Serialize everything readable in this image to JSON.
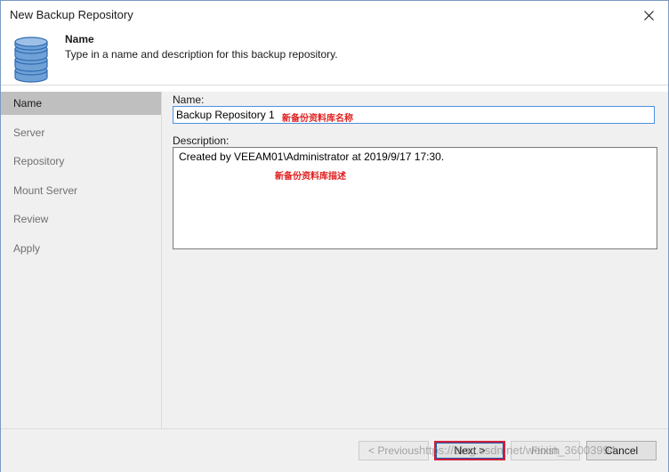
{
  "window": {
    "title": "New Backup Repository"
  },
  "header": {
    "title": "Name",
    "subtitle": "Type in a name and description for this backup repository."
  },
  "sidebar": {
    "items": [
      {
        "label": "Name",
        "active": true
      },
      {
        "label": "Server",
        "active": false
      },
      {
        "label": "Repository",
        "active": false
      },
      {
        "label": "Mount Server",
        "active": false
      },
      {
        "label": "Review",
        "active": false
      },
      {
        "label": "Apply",
        "active": false
      }
    ]
  },
  "form": {
    "name_label": "Name:",
    "name_value": "Backup Repository 1",
    "description_label": "Description:",
    "description_value": "Created by VEEAM01\\Administrator at 2019/9/17 17:30."
  },
  "annotations": {
    "name_note": "新备份资料库名称",
    "description_note": "新备份资料库描述"
  },
  "footer": {
    "previous_label": "< Previous",
    "next_label": "Next >",
    "finish_label": "Finish",
    "cancel_label": "Cancel"
  },
  "watermark": "https://blog.csdn.net/weixin_36003994",
  "colors": {
    "accent_border": "#4a90e2",
    "annotation_red": "#e02020",
    "highlight_red": "#d0203a"
  }
}
